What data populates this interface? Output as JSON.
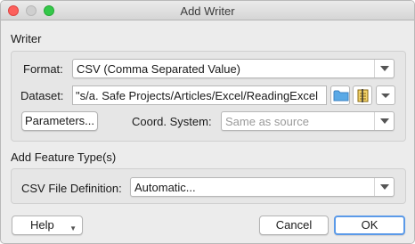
{
  "window": {
    "title": "Add Writer"
  },
  "writer": {
    "section_label": "Writer",
    "format_label": "Format:",
    "format_value": "CSV (Comma Separated Value)",
    "dataset_label": "Dataset:",
    "dataset_value": "s/a. Safe Projects/Articles/Excel/ReadingExcel\"",
    "parameters_button": "Parameters...",
    "coord_system_label": "Coord. System:",
    "coord_system_value": "Same as source"
  },
  "feature_type": {
    "section_label": "Add Feature Type(s)",
    "csv_def_label": "CSV File Definition:",
    "csv_def_value": "Automatic..."
  },
  "footer": {
    "help_button": "Help",
    "cancel_button": "Cancel",
    "ok_button": "OK"
  },
  "colors": {
    "close": "#fc605c",
    "minimize": "#cfcfcf",
    "maximize": "#34c84a",
    "primary_focus": "#5b9ae8"
  },
  "icons": [
    "folder-icon",
    "dataset-browse-icon",
    "chevron-down-icon"
  ]
}
